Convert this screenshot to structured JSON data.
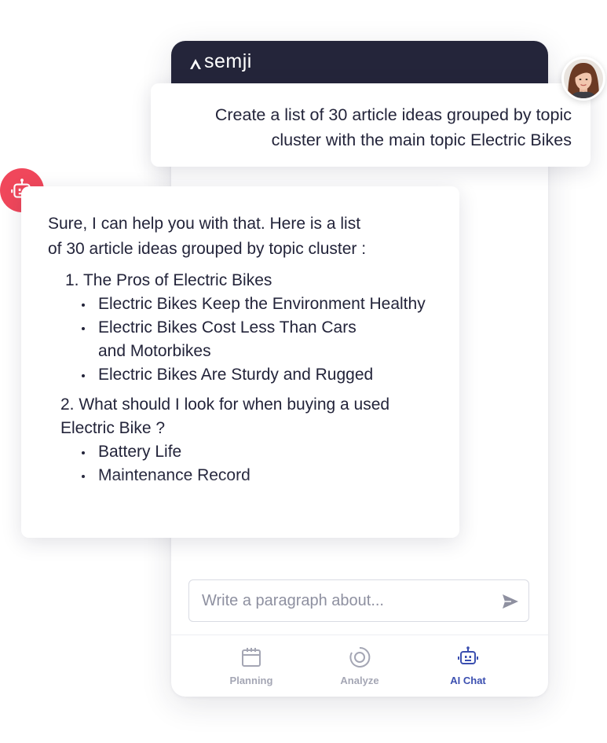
{
  "app": {
    "logo_text": "semji"
  },
  "user_message": {
    "line1": "Create a list of 30 article ideas grouped by topic",
    "line2": "cluster with the main topic Electric Bikes"
  },
  "bot_message": {
    "intro_line1": "Sure, I can help you with that. Here is a list",
    "intro_line2": "of 30 article ideas grouped by topic cluster :",
    "sections": [
      {
        "title": "1. The Pros of Electric Bikes",
        "items": [
          "Electric Bikes Keep the Environment Healthy",
          "Electric Bikes Cost Less Than Cars and Motorbikes",
          "Electric Bikes Are Sturdy and Rugged"
        ]
      },
      {
        "title_line1": "2.  What should I look for when buying a used",
        "title_line2": "Electric Bike ?",
        "items": [
          "Battery Life",
          "Maintenance Record"
        ]
      }
    ]
  },
  "composer": {
    "placeholder": "Write a paragraph about..."
  },
  "nav": {
    "items": [
      {
        "label": "Planning",
        "icon": "calendar-icon",
        "active": false
      },
      {
        "label": "Analyze",
        "icon": "analyze-icon",
        "active": false
      },
      {
        "label": "AI Chat",
        "icon": "robot-icon",
        "active": true
      }
    ]
  },
  "colors": {
    "header_bg": "#24253a",
    "bot_badge": "#f0475b",
    "nav_active": "#3b4fb0",
    "nav_inactive": "#a4a6b4"
  }
}
